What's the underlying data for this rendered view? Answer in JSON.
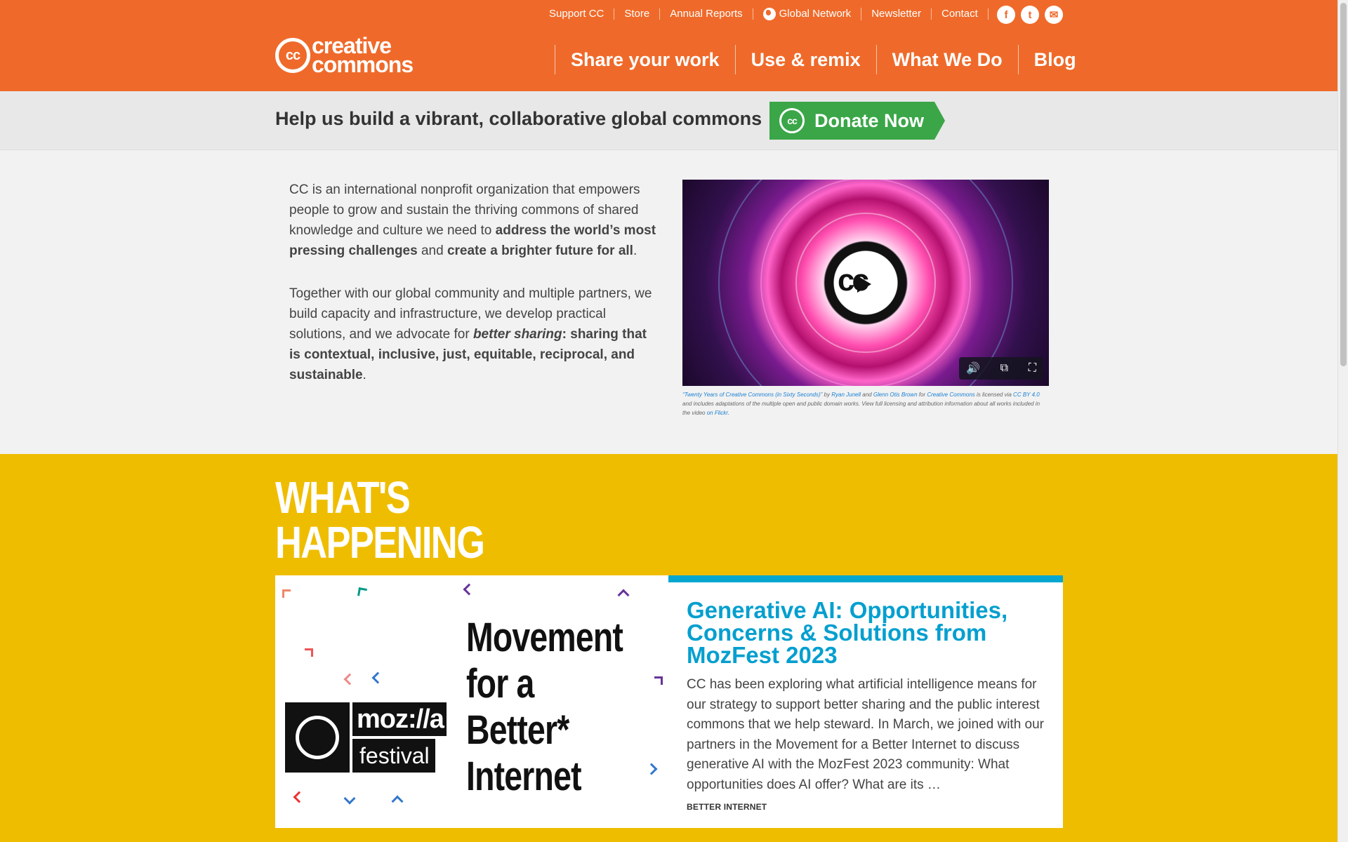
{
  "top_nav": {
    "links": [
      "Support CC",
      "Store",
      "Annual Reports",
      "Global Network",
      "Newsletter",
      "Contact"
    ],
    "socials": [
      {
        "icon": "facebook-icon",
        "glyph": "f"
      },
      {
        "icon": "twitter-icon",
        "glyph": "t"
      },
      {
        "icon": "email-icon",
        "glyph": "✉"
      }
    ]
  },
  "logo": {
    "mark": "cc",
    "line1": "creative",
    "line2": "commons"
  },
  "main_nav": [
    "Share your work",
    "Use & remix",
    "What We Do",
    "Blog"
  ],
  "donate_band": {
    "tagline": "Help us build a vibrant, collaborative global commons",
    "button": "Donate Now",
    "mark": "cc"
  },
  "intro": {
    "p1_a": "CC is an international nonprofit organization that empowers people to grow and sustain the thriving commons of shared knowledge and culture we need to ",
    "p1_b": "address the world’s most pressing challenges",
    "p1_c": " and ",
    "p1_d": "create a brighter future for all",
    "p1_e": ".",
    "p2_a": "Together with our global community and multiple partners, we build capacity and infrastructure, we develop practical solutions, and we advocate for ",
    "p2_b": "better sharing",
    "p2_c": ": sharing that is contextual, inclusive, just, equitable, reciprocal, and sustainable",
    "p2_d": "."
  },
  "video": {
    "overlay": "cc",
    "caption_title": "“Twenty Years of Creative Commons (in Sixty Seconds)”",
    "caption_by": " by ",
    "author1": "Ryan Junell",
    "caption_and": " and ",
    "author2": "Glenn Otis Brown",
    "caption_for": " for ",
    "org": "Creative Commons",
    "caption_lic": " is licensed via ",
    "license": "CC BY 4.0",
    "caption_rest": " and includes adaptations of the multiple open and public domain works. View full licensing and attribution information about all works included in the video ",
    "flickr": "on Flickr",
    "caption_end": "."
  },
  "happening": {
    "heading_1": "WHAT'S",
    "heading_2": "HAPPENING",
    "card": {
      "img_moz": "moz://a",
      "img_fest": "festival",
      "img_line1": "Movement",
      "img_line2": "for a",
      "img_line3": "Better*",
      "img_line4": "Internet",
      "title": "Generative AI: Opportunities, Concerns & Solutions from MozFest 2023",
      "excerpt": "CC has been exploring what artificial intelligence means for our strategy to support better sharing and the public interest commons that we help steward. In March, we joined with our partners in the Movement for a Better Internet to discuss generative AI with the MozFest 2023 community: What opportunities does AI offer? What are its …",
      "category": "BETTER INTERNET"
    }
  },
  "colors": {
    "brand_orange": "#ef6a2a",
    "donate_green": "#3aa648",
    "happening_yellow": "#efbd00",
    "accent_blue": "#05a6d0"
  }
}
